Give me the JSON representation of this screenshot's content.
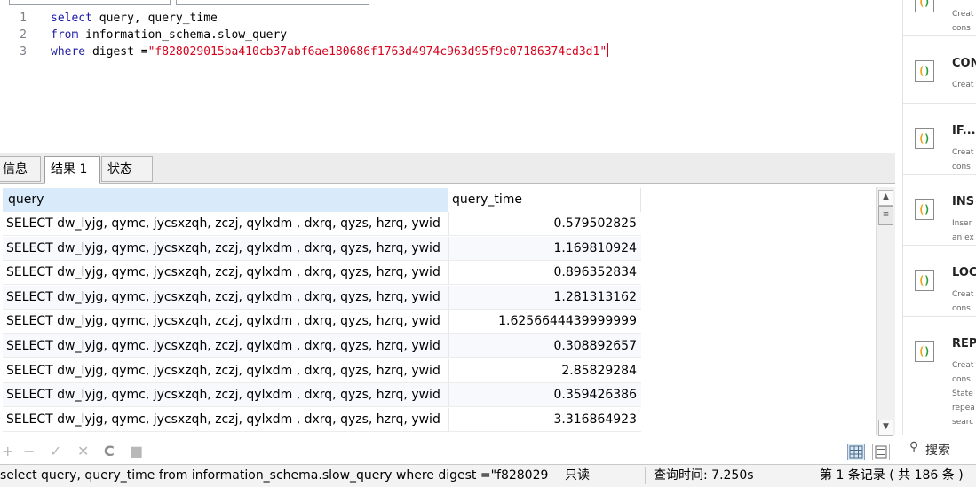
{
  "editor": {
    "lines": [
      {
        "num": "1",
        "parts": [
          {
            "t": "select",
            "c": "kw"
          },
          {
            "t": " query, query_time",
            "c": ""
          }
        ]
      },
      {
        "num": "2",
        "parts": [
          {
            "t": "from",
            "c": "kw"
          },
          {
            "t": " information_schema.slow_query",
            "c": ""
          }
        ]
      },
      {
        "num": "3",
        "parts": [
          {
            "t": "where",
            "c": "kw"
          },
          {
            "t": " digest =",
            "c": ""
          },
          {
            "t": "\"f828029015ba410cb37abf6ae180686f1763d4974c963d95f9c07186374cd3d1\"",
            "c": "str"
          }
        ]
      }
    ]
  },
  "snippets": [
    {
      "title": "",
      "desc": "Creat\ncons"
    },
    {
      "title": "CON",
      "desc": "Creat"
    },
    {
      "title": "IF...I",
      "desc": "Creat\ncons"
    },
    {
      "title": "INS",
      "desc": "Inser\nan ex"
    },
    {
      "title": "LOC",
      "desc": "Creat\ncons"
    },
    {
      "title": "REP",
      "desc": "Creat\ncons\nState\nrepea\nsearc"
    }
  ],
  "search": {
    "label": "搜索"
  },
  "tabs": [
    {
      "label": "信息",
      "active": false
    },
    {
      "label": "结果 1",
      "active": true
    },
    {
      "label": "状态",
      "active": false
    }
  ],
  "grid": {
    "columns": [
      "query",
      "query_time"
    ],
    "rows": [
      [
        "SELECT dw_lyjg, qymc, jycsxzqh, zczj, qylxdm , dxrq, qyzs, hzrq, ywid",
        "0.579502825"
      ],
      [
        "SELECT dw_lyjg, qymc, jycsxzqh, zczj, qylxdm , dxrq, qyzs, hzrq, ywid",
        "1.169810924"
      ],
      [
        "SELECT dw_lyjg, qymc, jycsxzqh, zczj, qylxdm , dxrq, qyzs, hzrq, ywid",
        "0.896352834"
      ],
      [
        "SELECT dw_lyjg, qymc, jycsxzqh, zczj, qylxdm , dxrq, qyzs, hzrq, ywid",
        "1.281313162"
      ],
      [
        "SELECT dw_lyjg, qymc, jycsxzqh, zczj, qylxdm , dxrq, qyzs, hzrq, ywid",
        "1.6256644439999999"
      ],
      [
        "SELECT dw_lyjg, qymc, jycsxzqh, zczj, qylxdm , dxrq, qyzs, hzrq, ywid",
        "0.308892657"
      ],
      [
        "SELECT dw_lyjg, qymc, jycsxzqh, zczj, qylxdm , dxrq, qyzs, hzrq, ywid",
        "2.85829284"
      ],
      [
        "SELECT dw_lyjg, qymc, jycsxzqh, zczj, qylxdm , dxrq, qyzs, hzrq, ywid",
        "0.359426386"
      ],
      [
        "SELECT dw_lyjg, qymc, jycsxzqh, zczj, qylxdm , dxrq, qyzs, hzrq, ywid",
        "3.316864923"
      ]
    ]
  },
  "toolbar": {
    "add": "+",
    "remove": "−",
    "apply": "✓",
    "discard": "✕",
    "refresh": "C",
    "stop": "■"
  },
  "status": {
    "sql": "select query, query_time from information_schema.slow_query where digest =\"f828029",
    "mode": "只读",
    "query_time": "查询时间: 7.250s",
    "records": "第 1 条记录 ( 共 186 条 )"
  },
  "colors": {
    "keyword": "#1a1aa6",
    "string": "#d9001b",
    "header_selected": "#d9ebfb"
  }
}
